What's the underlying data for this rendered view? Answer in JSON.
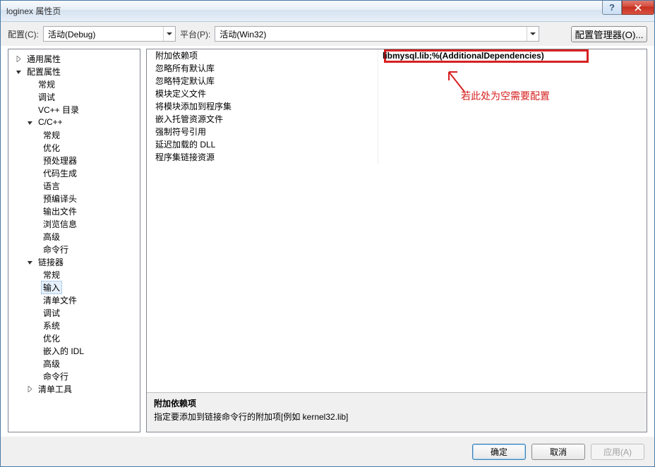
{
  "window": {
    "title": "loginex 属性页"
  },
  "toolbar": {
    "config_label": "配置(C):",
    "config_value": "活动(Debug)",
    "platform_label": "平台(P):",
    "platform_value": "活动(Win32)",
    "config_mgr": "配置管理器(O)..."
  },
  "tree": {
    "common": "通用属性",
    "config_props": "配置属性",
    "general": "常规",
    "debug": "调试",
    "vcdirs": "VC++ 目录",
    "cc": "C/C++",
    "cc_items": [
      "常规",
      "优化",
      "预处理器",
      "代码生成",
      "语言",
      "预编译头",
      "输出文件",
      "浏览信息",
      "高级",
      "命令行"
    ],
    "linker": "链接器",
    "linker_items": [
      "常规",
      "输入",
      "清单文件",
      "调试",
      "系统",
      "优化",
      "嵌入的 IDL",
      "高级",
      "命令行"
    ],
    "manifest_tool": "清单工具"
  },
  "props": {
    "rows": [
      {
        "name": "附加依赖项",
        "value": "libmysql.lib;%(AdditionalDependencies)"
      },
      {
        "name": "忽略所有默认库",
        "value": ""
      },
      {
        "name": "忽略特定默认库",
        "value": ""
      },
      {
        "name": "模块定义文件",
        "value": ""
      },
      {
        "name": "将模块添加到程序集",
        "value": ""
      },
      {
        "name": "嵌入托管资源文件",
        "value": ""
      },
      {
        "name": "强制符号引用",
        "value": ""
      },
      {
        "name": "延迟加载的 DLL",
        "value": ""
      },
      {
        "name": "程序集链接资源",
        "value": ""
      }
    ]
  },
  "annotation": "若此处为空需要配置",
  "desc": {
    "title": "附加依赖项",
    "text": "指定要添加到链接命令行的附加项[例如 kernel32.lib]"
  },
  "buttons": {
    "ok": "确定",
    "cancel": "取消",
    "apply": "应用(A)"
  }
}
